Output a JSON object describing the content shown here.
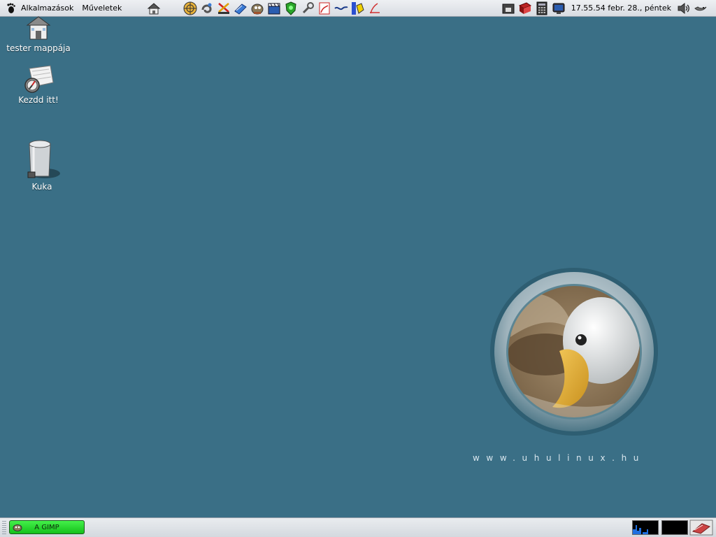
{
  "top_panel": {
    "applications_label": "Alkalmazások",
    "actions_label": "Műveletek",
    "clock": "17.55.54 febr. 28., péntek"
  },
  "desktop": {
    "icons": [
      {
        "label": "tester mappája",
        "icon": "home-folder-icon"
      },
      {
        "label": "Kezdd itt!",
        "icon": "start-here-icon"
      },
      {
        "label": "Kuka",
        "icon": "trash-icon"
      }
    ],
    "url_text": "www.uhulinux.hu"
  },
  "bottom_panel": {
    "task_label": "A GIMP"
  },
  "colors": {
    "desktop_bg": "#3a6f86",
    "task_button": "#22d42a"
  }
}
